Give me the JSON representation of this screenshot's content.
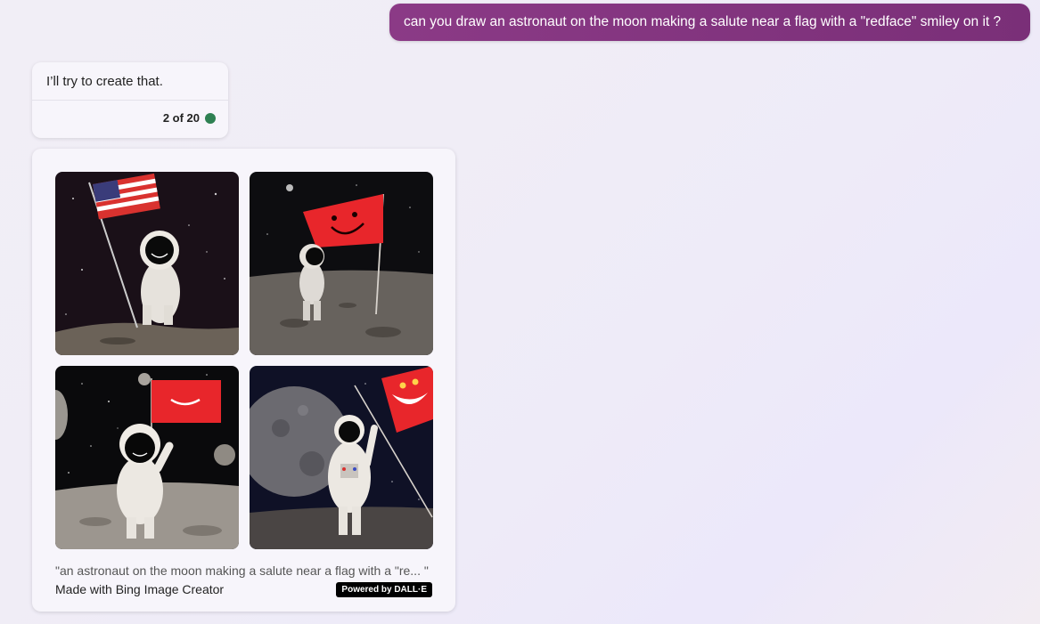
{
  "user_message": {
    "text": "can you draw an astronaut on the moon making a salute near a flag with a \"redface\" smiley on it ?"
  },
  "bot_reply": {
    "text": "I’ll try to create that.",
    "counter": "2 of 20",
    "status_color": "#2e8052"
  },
  "image_card": {
    "prompt_text": "\"an astronaut on the moon making a salute near a flag with a \"re... \"",
    "attribution": "Made with Bing Image Creator",
    "badge": "Powered by DALL·E"
  },
  "colors": {
    "user_bubble": "#8b3a86",
    "flag_red": "#e8262b"
  }
}
